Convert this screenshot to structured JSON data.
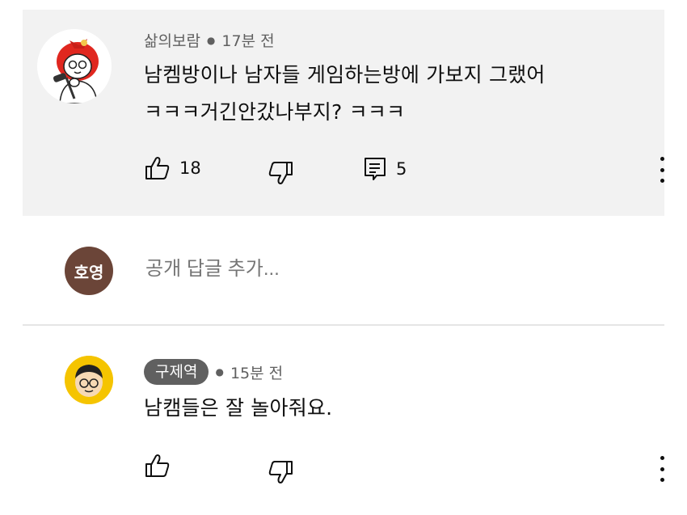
{
  "comments": [
    {
      "author": "삶의보람",
      "time": "17분 전",
      "text": "남켐방이나 남자들 게임하는방에 가보지 그랬어\nㅋㅋㅋ거긴안갔나부지? ㅋㅋㅋ",
      "likes": "18",
      "replies": "5"
    },
    {
      "author": "구제역",
      "time": "15분 전",
      "text": "남캠들은 잘 놀아줘요."
    }
  ],
  "reply_box": {
    "avatar_text": "호영",
    "placeholder": "공개 답글 추가..."
  },
  "icons": {
    "like": "thumbs-up-icon",
    "dislike": "thumbs-down-icon",
    "reply": "reply-comment-icon",
    "more": "more-vert-icon"
  },
  "colors": {
    "highlight_bg": "#f2f2f2",
    "my_avatar_bg": "#6b4538",
    "author_pill_bg": "#606060"
  }
}
